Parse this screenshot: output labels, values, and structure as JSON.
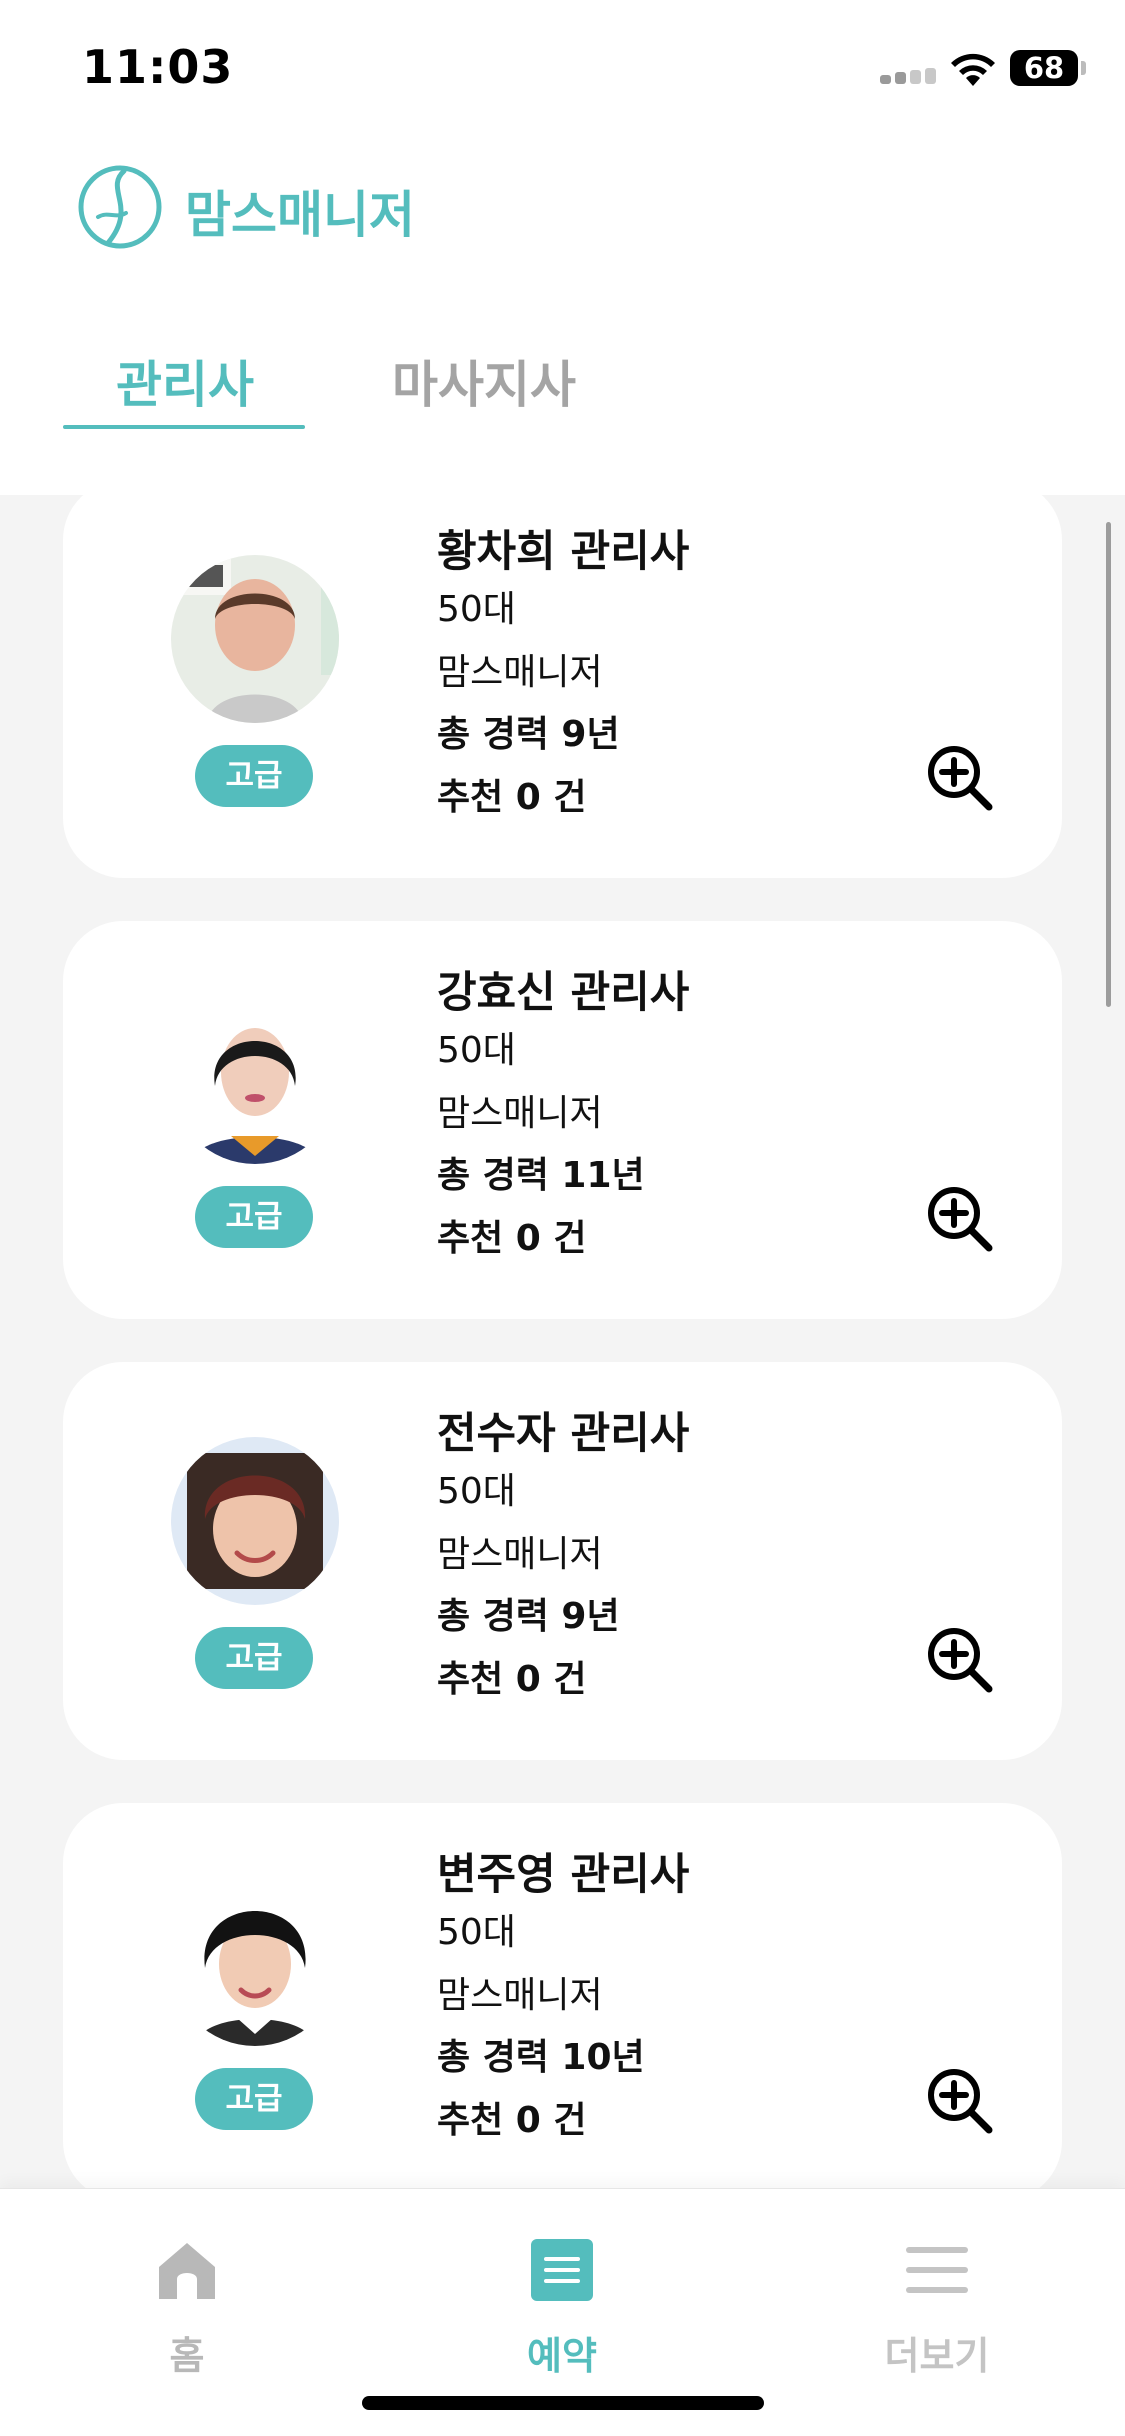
{
  "status_bar": {
    "time": "11:03",
    "battery": "68"
  },
  "header": {
    "brand": "맘스매니저"
  },
  "tabs": [
    {
      "label": "관리사"
    },
    {
      "label": "마사지사"
    }
  ],
  "managers": [
    {
      "name": "황차희 관리사",
      "age": "50대",
      "company": "맘스매니저",
      "career": "총 경력 9년",
      "recommend": "추천 0 건",
      "grade": "고급"
    },
    {
      "name": "강효신 관리사",
      "age": "50대",
      "company": "맘스매니저",
      "career": "총 경력 11년",
      "recommend": "추천 0 건",
      "grade": "고급"
    },
    {
      "name": "전수자 관리사",
      "age": "50대",
      "company": "맘스매니저",
      "career": "총 경력 9년",
      "recommend": "추천 0 건",
      "grade": "고급"
    },
    {
      "name": "변주영 관리사",
      "age": "50대",
      "company": "맘스매니저",
      "career": "총 경력 10년",
      "recommend": "추천 0 건",
      "grade": "고급"
    }
  ],
  "bottom_nav": [
    {
      "label": "홈",
      "icon": "home-icon"
    },
    {
      "label": "예약",
      "icon": "reservation-list-icon"
    },
    {
      "label": "더보기",
      "icon": "menu-icon"
    }
  ],
  "colors": {
    "accent": "#54bdbd",
    "inactive": "#a4a4a4",
    "list_bg": "#f4f4f4"
  }
}
